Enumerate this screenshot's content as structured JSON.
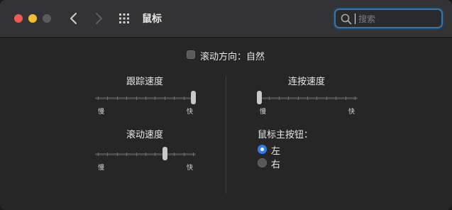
{
  "window": {
    "title": "鼠标"
  },
  "search": {
    "placeholder": "搜索",
    "value": ""
  },
  "scroll_direction": {
    "label": "滚动方向：自然",
    "checked": false
  },
  "tracking_speed": {
    "label": "跟踪速度",
    "slow": "慢",
    "fast": "快",
    "value_fraction": 1.0
  },
  "scroll_speed": {
    "label": "滚动速度",
    "slow": "慢",
    "fast": "快",
    "value_fraction": 0.7
  },
  "double_click_speed": {
    "label": "连按速度",
    "slow": "慢",
    "fast": "快",
    "value_fraction": 0.0
  },
  "primary_button": {
    "label": "鼠标主按钮：",
    "options": [
      {
        "label": "左",
        "selected": true
      },
      {
        "label": "右",
        "selected": false
      }
    ]
  },
  "colors": {
    "accent": "#2f7cf6",
    "search_focus": "#3f74a8",
    "close": "#ee5a52",
    "minimize": "#f2be30"
  },
  "icons": [
    "close-button",
    "minimize-button",
    "zoom-button",
    "chevron-left-icon",
    "chevron-right-icon",
    "grid-icon",
    "search-icon"
  ]
}
